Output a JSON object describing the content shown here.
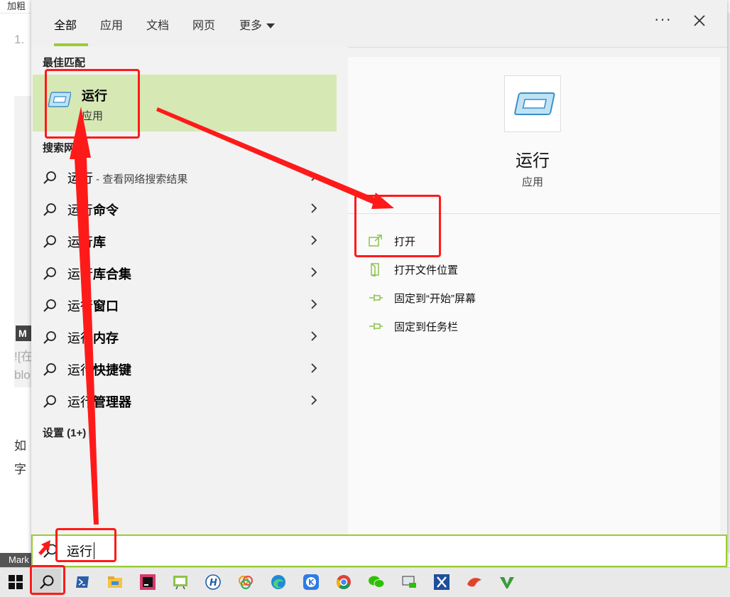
{
  "background": {
    "toolbar_text": "加粗",
    "list_num": "1.",
    "img_alt_1": "![在",
    "img_alt_2": "blo",
    "para_1": "如",
    "para_2": "字",
    "status_text": "Mark",
    "img_tag": "M"
  },
  "panel": {
    "tabs": [
      {
        "label": "全部",
        "active": true
      },
      {
        "label": "应用",
        "active": false
      },
      {
        "label": "文档",
        "active": false
      },
      {
        "label": "网页",
        "active": false
      },
      {
        "label": "更多",
        "active": false
      }
    ],
    "more_options": "···",
    "accent": "#9acd32",
    "best_match": {
      "section": "最佳匹配",
      "title": "运行",
      "subtitle": "应用"
    },
    "web_section": "搜索网页",
    "web_results": [
      {
        "prefix": "运行",
        "bold": "",
        "hint": " - 查看网络搜索结果"
      },
      {
        "prefix": "运行",
        "bold": "命令",
        "hint": ""
      },
      {
        "prefix": "运行",
        "bold": "库",
        "hint": ""
      },
      {
        "prefix": "运行",
        "bold": "库合集",
        "hint": ""
      },
      {
        "prefix": "运行",
        "bold": "窗口",
        "hint": ""
      },
      {
        "prefix": "运行",
        "bold": "内存",
        "hint": ""
      },
      {
        "prefix": "运行",
        "bold": "快捷键",
        "hint": ""
      },
      {
        "prefix": "运行",
        "bold": "管理器",
        "hint": ""
      }
    ],
    "settings_section": "设置 (1+)",
    "detail": {
      "title": "运行",
      "subtitle": "应用",
      "actions": [
        {
          "label": "打开",
          "icon": "open-icon"
        },
        {
          "label": "打开文件位置",
          "icon": "folder-icon"
        },
        {
          "label": "固定到“开始”屏幕",
          "icon": "pin-icon"
        },
        {
          "label": "固定到任务栏",
          "icon": "pin-icon"
        }
      ]
    },
    "search_value": "运行"
  },
  "taskbar": {
    "icons": [
      "windows-start-icon",
      "search-icon",
      "powershell-icon",
      "file-explorer-icon",
      "intellij-icon",
      "whiteboard-app-icon",
      "h-app-icon",
      "colorful-app-icon",
      "edge-icon",
      "k-app-icon",
      "chrome-icon",
      "wechat-icon",
      "remote-desktop-icon",
      "x-app-icon",
      "bird-app-icon",
      "v-app-icon"
    ]
  },
  "annotation_color": "#ff1a1a"
}
